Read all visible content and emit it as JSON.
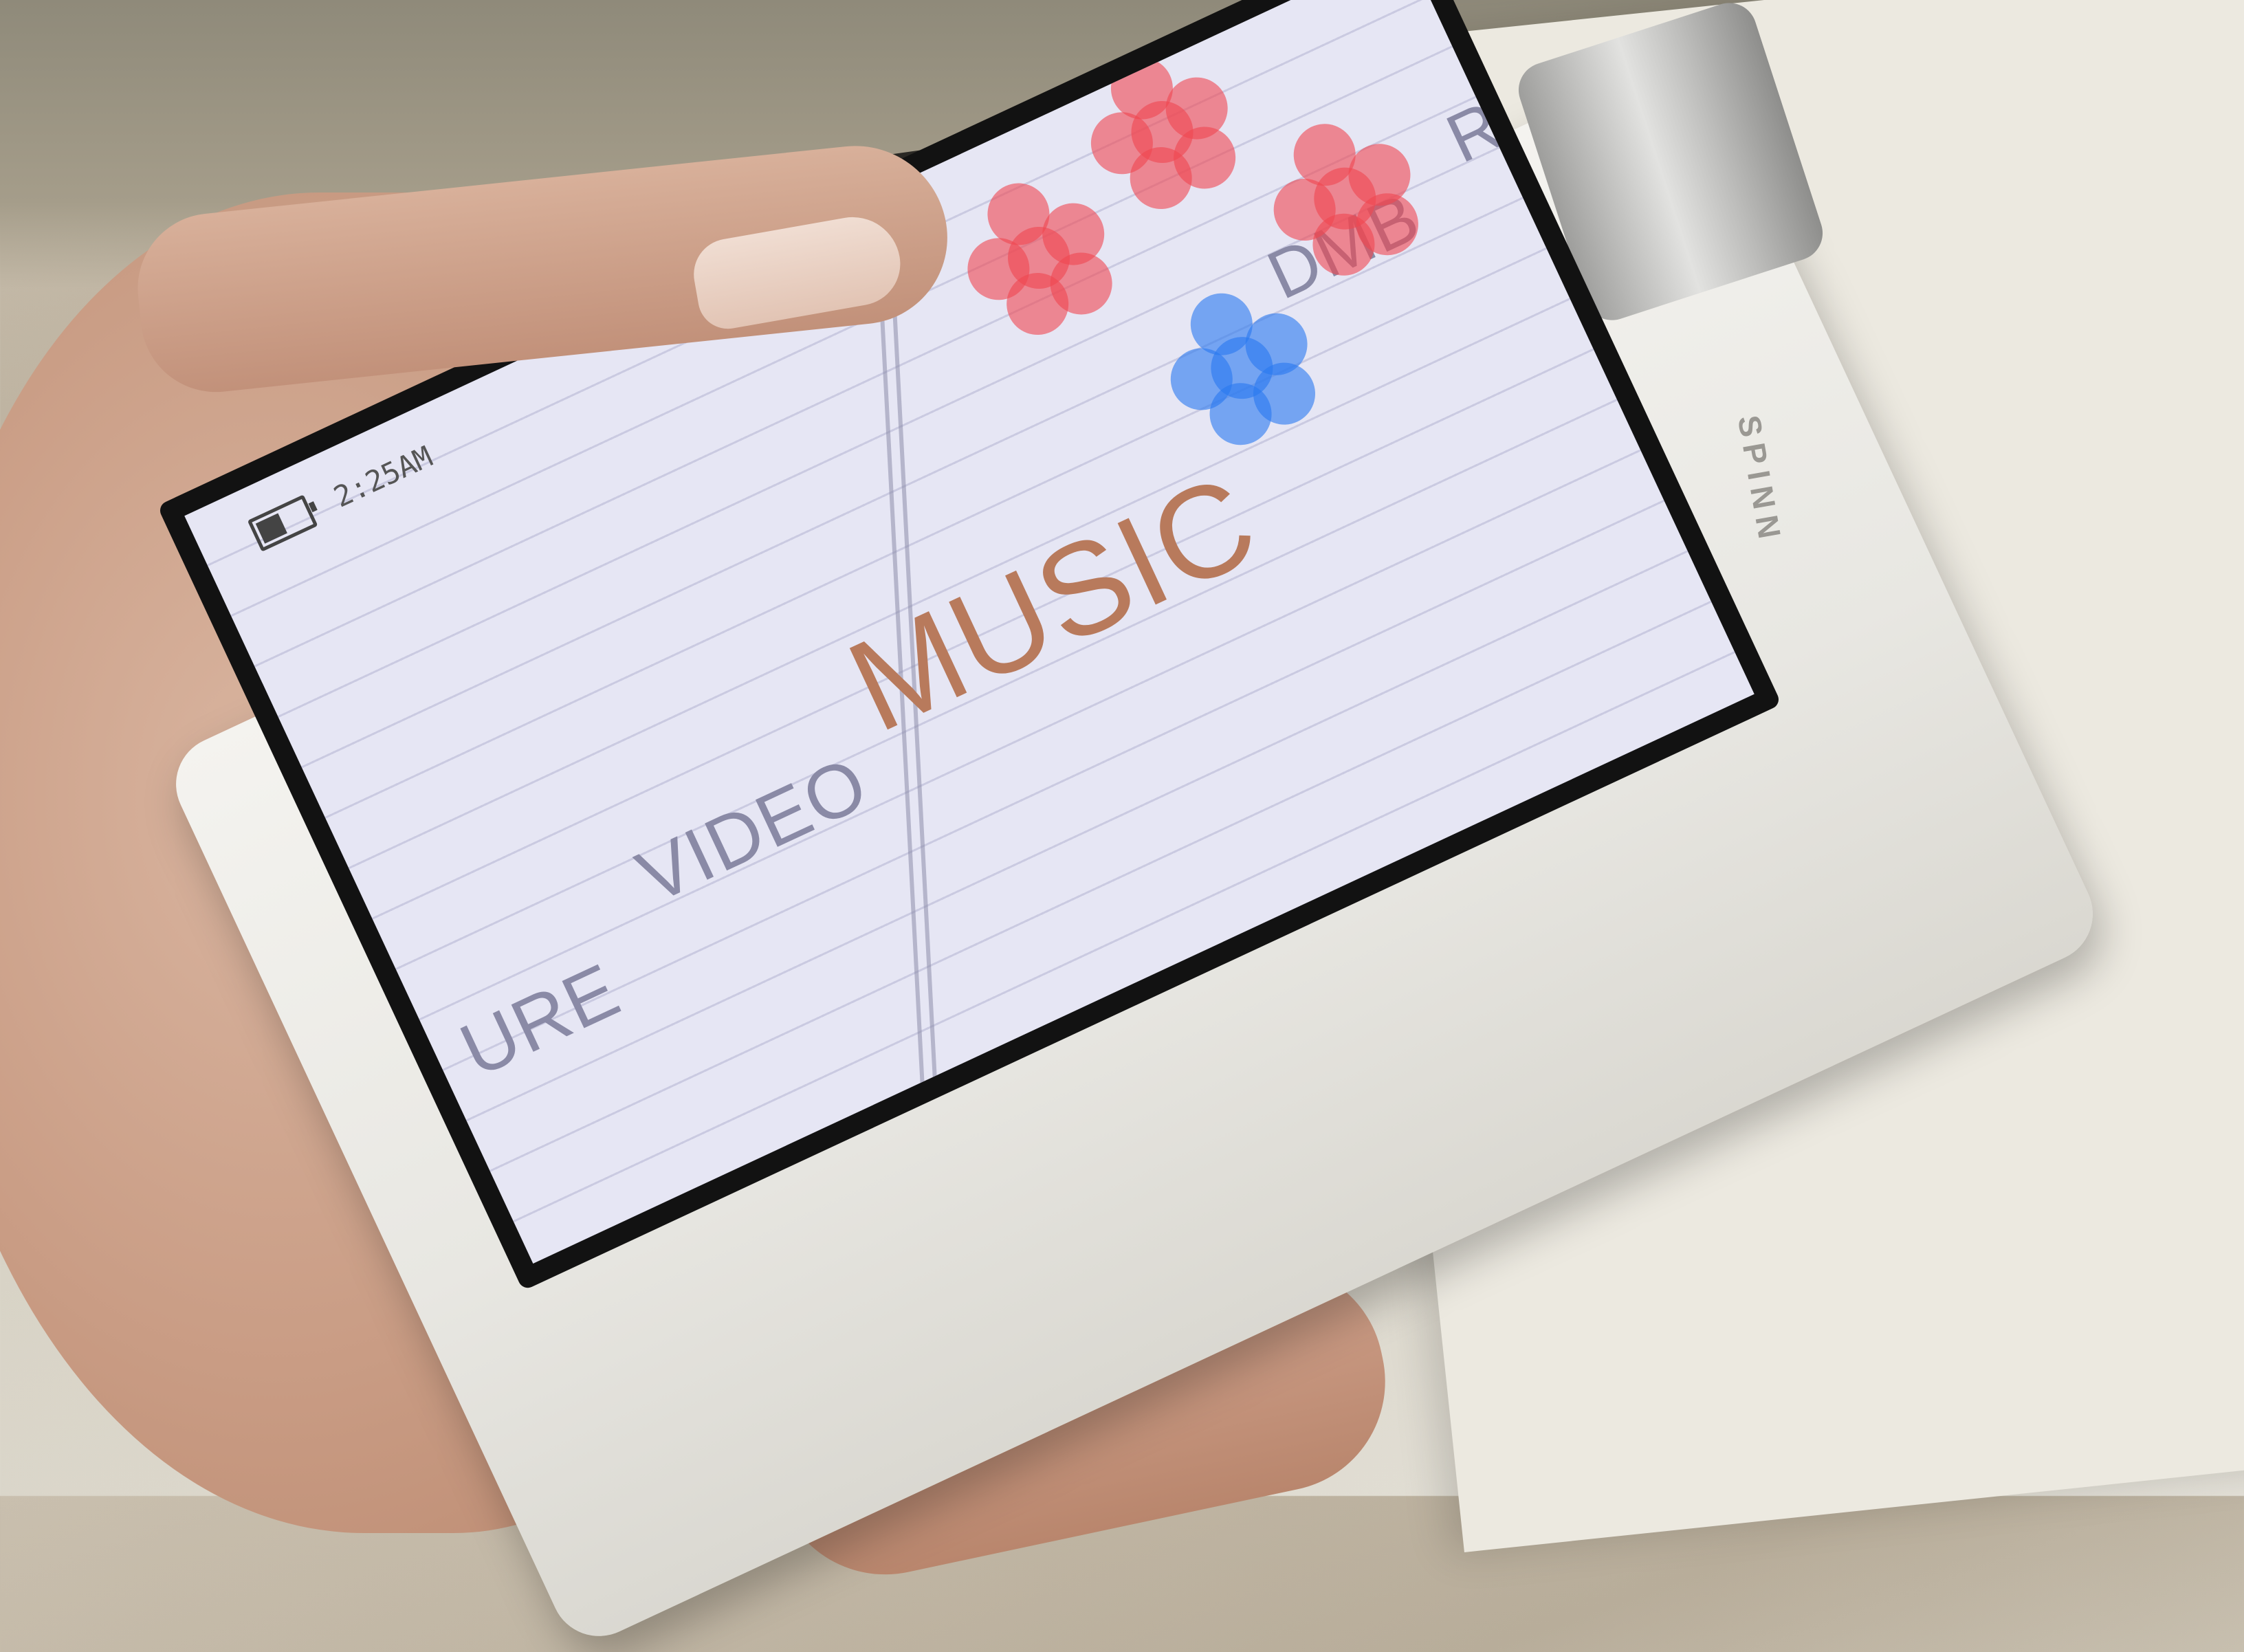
{
  "device": {
    "brand": "SPINN"
  },
  "screen": {
    "status": {
      "clock": "2:25AM",
      "battery_icon": "battery-icon",
      "signal_icon": "signal-icon"
    },
    "menu": {
      "items": [
        "URE",
        "VIDEO",
        "MUSIC",
        "DMB",
        "RA"
      ],
      "selected": "MUSIC"
    },
    "colors": {
      "screen_bg": "#e6e6f4",
      "selected_text": "#b87a5c",
      "unselected_text": "#8a8aa6",
      "flower_red": "#f04650",
      "flower_blue": "#2878f0"
    }
  }
}
